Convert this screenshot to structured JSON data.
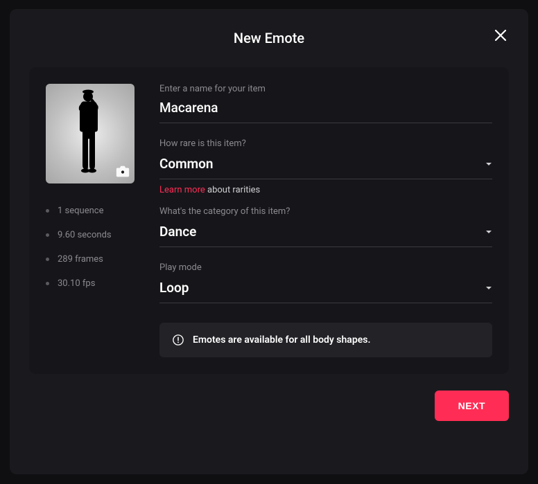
{
  "modal": {
    "title": "New Emote"
  },
  "stats": {
    "sequence": "1 sequence",
    "duration": "9.60 seconds",
    "frames": "289 frames",
    "fps": "30.10 fps"
  },
  "fields": {
    "name_label": "Enter a name for your item",
    "name_value": "Macarena",
    "rarity_label": "How rare is this item?",
    "rarity_value": "Common",
    "learn_more": "Learn more",
    "about_rarities": " about rarities",
    "category_label": "What's the category of this item?",
    "category_value": "Dance",
    "playmode_label": "Play mode",
    "playmode_value": "Loop"
  },
  "info": {
    "message": "Emotes are available for all body shapes."
  },
  "footer": {
    "next": "NEXT"
  }
}
